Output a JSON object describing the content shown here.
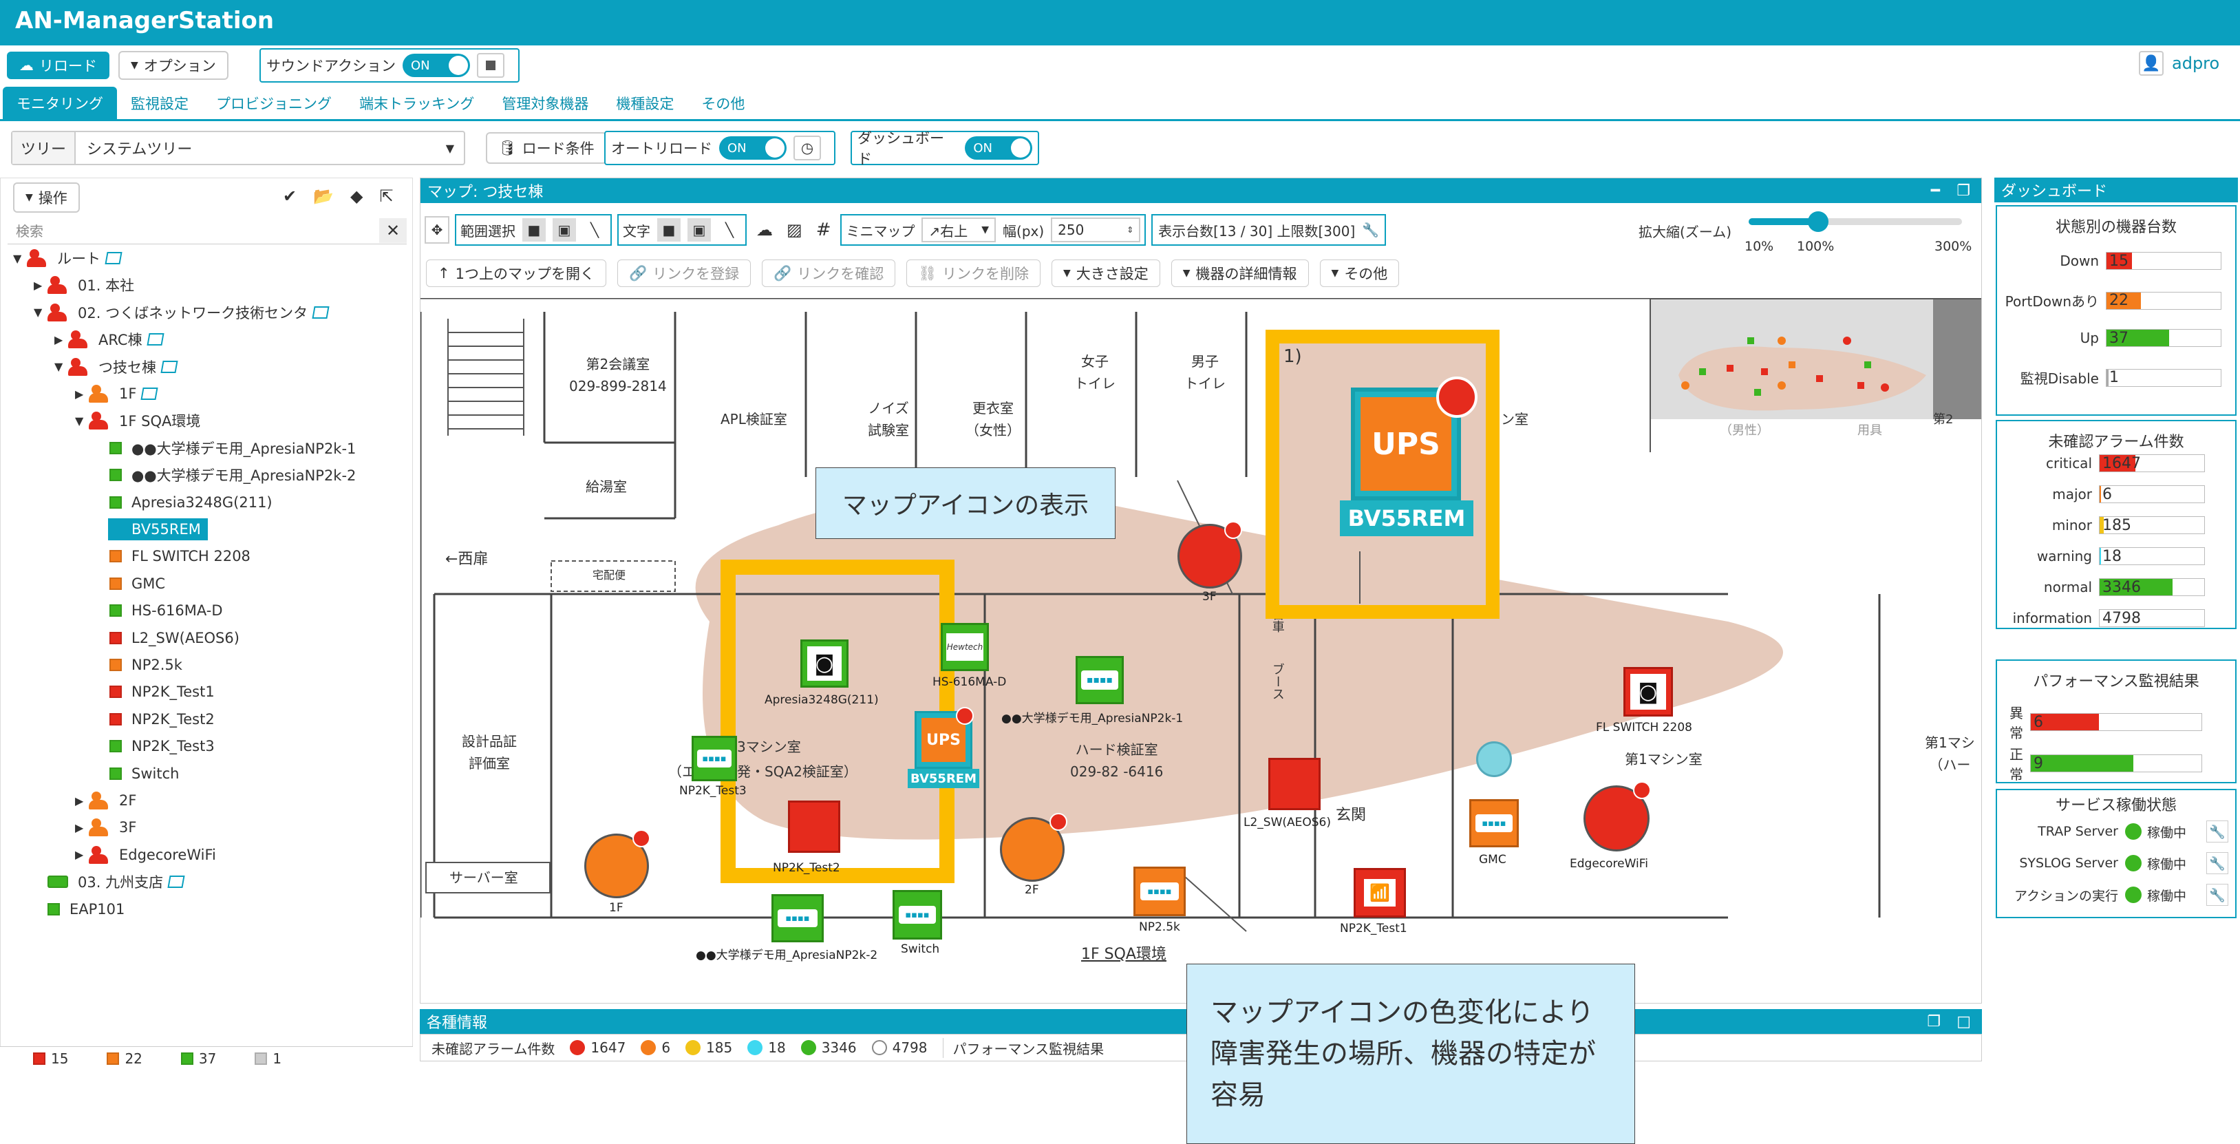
{
  "app": {
    "title": "AN-ManagerStation",
    "user": "adpro"
  },
  "toolbar": {
    "reload": "リロード",
    "options": "オプション",
    "sound_action": "サウンドアクション",
    "toggle_on": "ON"
  },
  "nav": {
    "tabs": [
      "モニタリング",
      "監視設定",
      "プロビジョニング",
      "端末トラッキング",
      "管理対象機器",
      "機種設定",
      "その他"
    ]
  },
  "filter": {
    "tree_label": "ツリー",
    "tree_value": "システムツリー",
    "load_condition": "ロード条件",
    "auto_reload": "オートリロード",
    "dashboard": "ダッシュボード"
  },
  "left": {
    "ops": "操作",
    "search_placeholder": "検索",
    "tree": [
      {
        "label": "ルート",
        "icon": "person-red",
        "level": 0,
        "caret": "▼",
        "map": true
      },
      {
        "label": "01. 本社",
        "icon": "person-red",
        "level": 1,
        "caret": "▶"
      },
      {
        "label": "02. つくばネットワーク技術センタ",
        "icon": "person-red",
        "level": 1,
        "caret": "▼",
        "map": true
      },
      {
        "label": "ARC棟",
        "icon": "person-red",
        "level": 2,
        "caret": "▶",
        "map": true
      },
      {
        "label": "つ技セ棟",
        "icon": "person-red",
        "level": 2,
        "caret": "▼",
        "map": true
      },
      {
        "label": "1F",
        "icon": "person-orange",
        "level": 3,
        "caret": "▶",
        "map": true
      },
      {
        "label": "1F SQA環境",
        "icon": "person-red",
        "level": 3,
        "caret": "▼"
      },
      {
        "label": "●●大学様デモ用_ApresiaNP2k-1",
        "icon": "sq-green",
        "level": 4
      },
      {
        "label": "●●大学様デモ用_ApresiaNP2k-2",
        "icon": "sq-green",
        "level": 4
      },
      {
        "label": "Apresia3248G(211)",
        "icon": "sq-green",
        "level": 4
      },
      {
        "label": "BV55REM",
        "icon": "sq-orange",
        "level": 4,
        "selected": true
      },
      {
        "label": "FL SWITCH 2208",
        "icon": "sq-orange",
        "level": 4
      },
      {
        "label": "GMC",
        "icon": "sq-orange",
        "level": 4
      },
      {
        "label": "HS-616MA-D",
        "icon": "sq-green",
        "level": 4
      },
      {
        "label": "L2_SW(AEOS6)",
        "icon": "sq-red",
        "level": 4
      },
      {
        "label": "NP2.5k",
        "icon": "sq-orange",
        "level": 4
      },
      {
        "label": "NP2K_Test1",
        "icon": "sq-red",
        "level": 4
      },
      {
        "label": "NP2K_Test2",
        "icon": "sq-red",
        "level": 4
      },
      {
        "label": "NP2K_Test3",
        "icon": "sq-green",
        "level": 4
      },
      {
        "label": "Switch",
        "icon": "sq-green",
        "level": 4
      },
      {
        "label": "2F",
        "icon": "person-orange",
        "level": 3,
        "caret": "▶"
      },
      {
        "label": "3F",
        "icon": "person-orange",
        "level": 3,
        "caret": "▶"
      },
      {
        "label": "EdgecoreWiFi",
        "icon": "person-red",
        "level": 3,
        "caret": "▶"
      },
      {
        "label": "03. 九州支店",
        "icon": "folder-green",
        "level": 1,
        "map": true
      },
      {
        "label": "EAP101",
        "icon": "sq-green",
        "level": 1
      }
    ],
    "status_counts": [
      "15",
      "22",
      "37",
      "1"
    ]
  },
  "map": {
    "title": "マップ: つ技セ棟",
    "range_select": "範囲選択",
    "text": "文字",
    "minimap": "ミニマップ",
    "minimap_pos": "↗右上",
    "width_label": "幅(px)",
    "width_value": "250",
    "display_count": "表示台数[13 / 30] 上限数[300]",
    "zoom_label": "拡大縮(ズーム)",
    "zoom_ticks": [
      "10%",
      "100%",
      "300%"
    ],
    "open_parent": "1つ上のマップを開く",
    "link_register": "リンクを登録",
    "link_check": "リンクを確認",
    "link_delete": "リンクを削除",
    "size_settings": "大きさ設定",
    "device_details": "機器の詳細情報",
    "other": "その他",
    "rooms": {
      "meeting2": "第2会議室",
      "meeting2_tel": "029-899-2814",
      "apl": "APL検証室",
      "noise1": "ノイズ",
      "noise2": "試験室",
      "locker1": "更衣室",
      "locker2": "（女性）",
      "wc_f1": "女子",
      "wc_f2": "トイレ",
      "wc_m1": "男子",
      "wc_m2": "トイレ",
      "kyuto": "給湯室",
      "nishi": "←西扉",
      "takuhai": "宅配便",
      "sekkei1": "設計品証",
      "sekkei2": "評価室",
      "server": "サーバー室",
      "machine3": "3マシン室",
      "machine3b": "（エ　　開発・SQA2検証室）",
      "hard": "ハード検証室",
      "hard_tel": "029-82 -6416",
      "genkan": "玄関",
      "machine1": "第1マシン室",
      "machine1r": "第1マシ",
      "machine1r2": "（ハー",
      "sqa_label": "1F SQA環境",
      "booth": "ブース",
      "daisha": "台車",
      "chin": "ン室",
      "partial1": "1)"
    },
    "devices": {
      "ups_big": "UPS",
      "bv_big": "BV55REM",
      "apresia": "Apresia3248G(211)",
      "hs616": "HS-616MA-D",
      "np2k1": "●●大学様デモ用_ApresiaNP2k-1",
      "np2k2": "●●大学様デモ用_ApresiaNP2k-2",
      "ups": "UPS",
      "bv": "BV55REM",
      "np2ktest3": "NP2K_Test3",
      "np2ktest2": "NP2K_Test2",
      "np2ktest1": "NP2K_Test1",
      "switch": "Switch",
      "f2": "2F",
      "f1": "1F",
      "f3": "3F",
      "np25k": "NP2.5k",
      "l2sw": "L2_SW(AEOS6)",
      "flswitch": "FL SWITCH 2208",
      "gmc": "GMC",
      "edgecore": "EdgecoreWiFi",
      "hs_logo": "Hewtech"
    },
    "minimap_texts": [
      "（男性）",
      "用具",
      "第2"
    ]
  },
  "callouts": {
    "map_icon": "マップアイコンの表示",
    "color_change": "マップアイコンの色変化により障害発生の場所、機器の特定が容易"
  },
  "info": {
    "title": "各種情報",
    "unconfirmed": "未確認アラーム件数",
    "counts": [
      "1647",
      "6",
      "185",
      "18",
      "3346",
      "4798"
    ],
    "perf": "パフォーマンス監視結果"
  },
  "dashboard": {
    "title": "ダッシュボード",
    "state_title": "状態別の機器台数",
    "state_rows": [
      {
        "label": "Down",
        "value": "15",
        "color": "#e52b1d",
        "frac": 0.22
      },
      {
        "label": "PortDownあり",
        "value": "22",
        "color": "#f47d1c",
        "frac": 0.3
      },
      {
        "label": "Up",
        "value": "37",
        "color": "#3cb521",
        "frac": 0.55
      },
      {
        "label": "監視Disable",
        "value": "1",
        "color": "#aaa",
        "frac": 0.02
      }
    ],
    "alarm_title": "未確認アラーム件数",
    "alarm_rows": [
      {
        "label": "critical",
        "value": "1647",
        "color": "#e52b1d",
        "frac": 0.34
      },
      {
        "label": "major",
        "value": "6",
        "color": "#f47d1c",
        "frac": 0.01
      },
      {
        "label": "minor",
        "value": "185",
        "color": "#f2c418",
        "frac": 0.04
      },
      {
        "label": "warning",
        "value": "18",
        "color": "#3ed8f0",
        "frac": 0.01
      },
      {
        "label": "normal",
        "value": "3346",
        "color": "#3cb521",
        "frac": 0.7
      },
      {
        "label": "information",
        "value": "4798",
        "color": "#ffffff",
        "frac": 1.0
      }
    ],
    "perf_title": "パフォーマンス監視結果",
    "perf_rows": [
      {
        "label": "異常",
        "value": "6",
        "color": "#e52b1d",
        "frac": 0.4
      },
      {
        "label": "正常",
        "value": "9",
        "color": "#3cb521",
        "frac": 0.6
      }
    ],
    "service_title": "サービス稼働状態",
    "service_rows": [
      {
        "label": "TRAP Server",
        "status": "稼働中"
      },
      {
        "label": "SYSLOG Server",
        "status": "稼働中"
      },
      {
        "label": "アクションの実行",
        "status": "稼働中"
      }
    ]
  }
}
